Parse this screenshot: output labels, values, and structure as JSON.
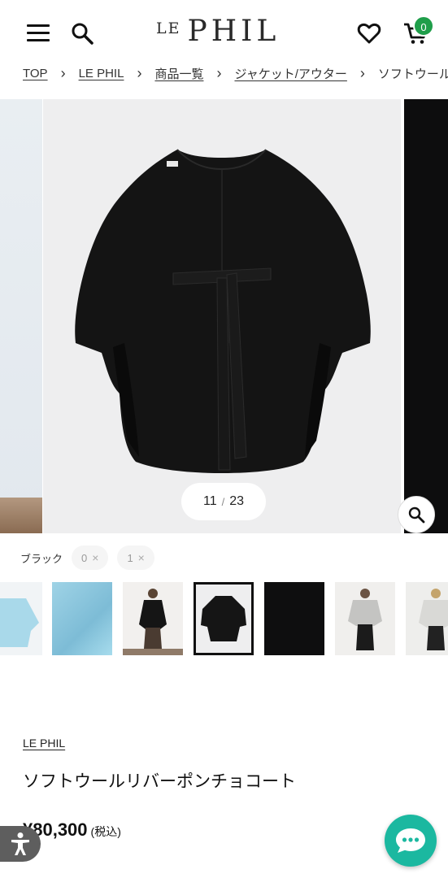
{
  "header": {
    "logo_prefix": "LE",
    "logo_main": "PHIL",
    "cart_count": "0",
    "icons": [
      "menu-icon",
      "search-icon",
      "heart-icon",
      "cart-icon"
    ],
    "accent_color": "#1f9e4a"
  },
  "breadcrumb": {
    "items": [
      "TOP",
      "LE PHIL",
      "商品一覧",
      "ジャケット/アウター",
      "ソフトウール"
    ]
  },
  "gallery": {
    "current": "11",
    "total": "23"
  },
  "color": {
    "label": "ブラック",
    "options": [
      {
        "value": "0"
      },
      {
        "value": "1"
      }
    ]
  },
  "product": {
    "brand": "LE PHIL",
    "name": "ソフトウールリバーポンチョコート",
    "price": "¥80,300",
    "tax_note": "(税込)"
  },
  "chat": {
    "color": "#1bb8a0"
  }
}
